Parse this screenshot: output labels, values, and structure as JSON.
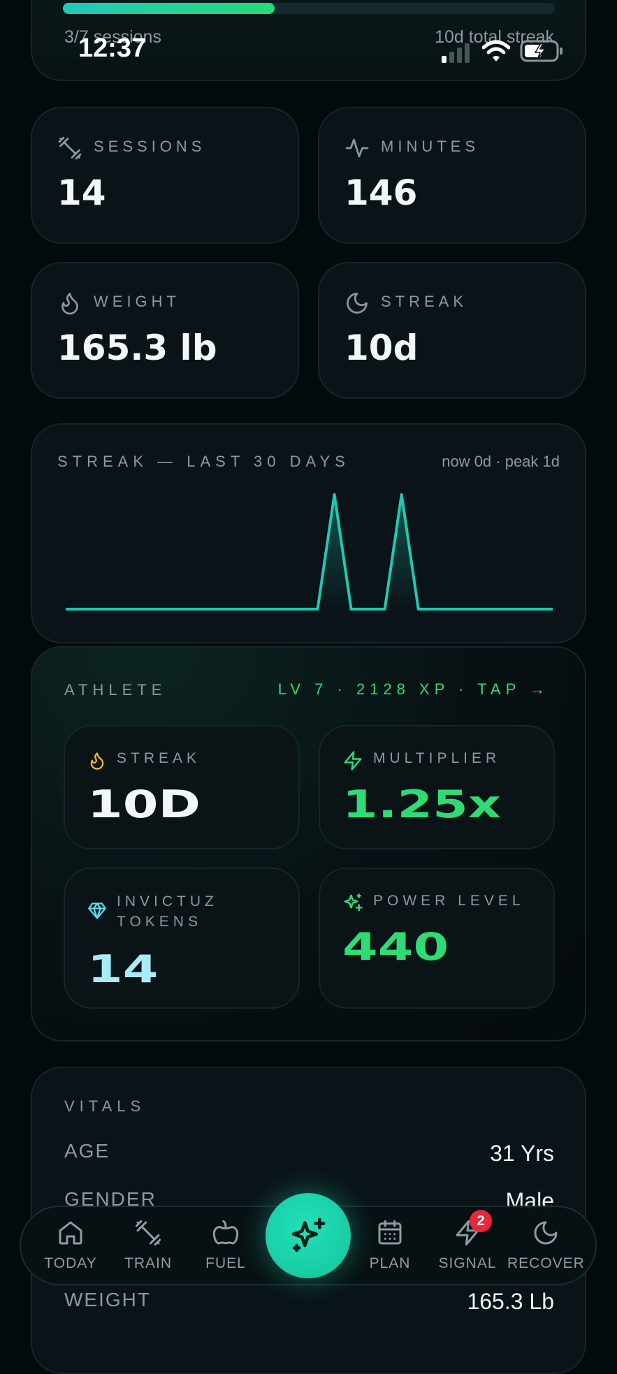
{
  "status_bar": {
    "time": "12:37"
  },
  "progress": {
    "fraction": 0.43,
    "left_text": "3/7 sessions",
    "right_text": "10d total streak"
  },
  "stats": [
    {
      "label": "SESSIONS",
      "value": "14",
      "icon": "dumbbell-icon"
    },
    {
      "label": "MINUTES",
      "value": "146",
      "icon": "pulse-icon"
    },
    {
      "label": "WEIGHT",
      "value": "165.3 lb",
      "icon": "flame-icon"
    },
    {
      "label": "STREAK",
      "value": "10d",
      "icon": "moon-icon"
    }
  ],
  "streak_chart": {
    "title": "STREAK — LAST 30 DAYS",
    "summary": "now 0d · peak 1d"
  },
  "chart_data": {
    "type": "line",
    "x": [
      1,
      2,
      3,
      4,
      5,
      6,
      7,
      8,
      9,
      10,
      11,
      12,
      13,
      14,
      15,
      16,
      17,
      18,
      19,
      20,
      21,
      22,
      23,
      24,
      25,
      26,
      27,
      28,
      29,
      30
    ],
    "series": [
      {
        "values": [
          0,
          0,
          0,
          0,
          0,
          0,
          0,
          0,
          0,
          0,
          0,
          0,
          0,
          0,
          0,
          0,
          1,
          0,
          0,
          0,
          1,
          0,
          0,
          0,
          0,
          0,
          0,
          0,
          0,
          0
        ]
      }
    ],
    "ylim": [
      0,
      1
    ],
    "color": "#1fc9b0"
  },
  "athlete": {
    "title": "ATHLETE",
    "level_text": "LV 7 · 2128 XP · TAP →",
    "tiles": [
      {
        "label": "STREAK",
        "value": "10D",
        "icon": "flame-icon",
        "color": "#f2f6f6"
      },
      {
        "label": "MULTIPLIER",
        "value": "1.25x",
        "icon": "bolt-icon",
        "color": "#2edb75"
      },
      {
        "label": "INVICTUZ TOKENS",
        "value": "14",
        "icon": "diamond-icon",
        "color": "#a8ecf8"
      },
      {
        "label": "POWER LEVEL",
        "value": "440",
        "icon": "sparkle-icon",
        "color": "#2edb75"
      }
    ]
  },
  "vitals": {
    "title": "VITALS",
    "rows": [
      {
        "label": "AGE",
        "value": "31 Yrs"
      },
      {
        "label": "GENDER",
        "value": "Male"
      },
      {
        "label": "WEIGHT",
        "value": "165.3 Lb"
      }
    ]
  },
  "nav": {
    "items": [
      {
        "label": "TODAY",
        "icon": "home-icon"
      },
      {
        "label": "TRAIN",
        "icon": "dumbbell-icon"
      },
      {
        "label": "FUEL",
        "icon": "apple-icon"
      },
      {
        "label": "PLAN",
        "icon": "calendar-icon"
      },
      {
        "label": "SIGNAL",
        "icon": "bolt-icon",
        "badge": "2"
      },
      {
        "label": "RECOVER",
        "icon": "moon-icon"
      }
    ],
    "center_icon": "sparkle-icon"
  },
  "colors": {
    "accent": "#1fc9b0",
    "green": "#2edb75",
    "badge": "#e5283a"
  }
}
